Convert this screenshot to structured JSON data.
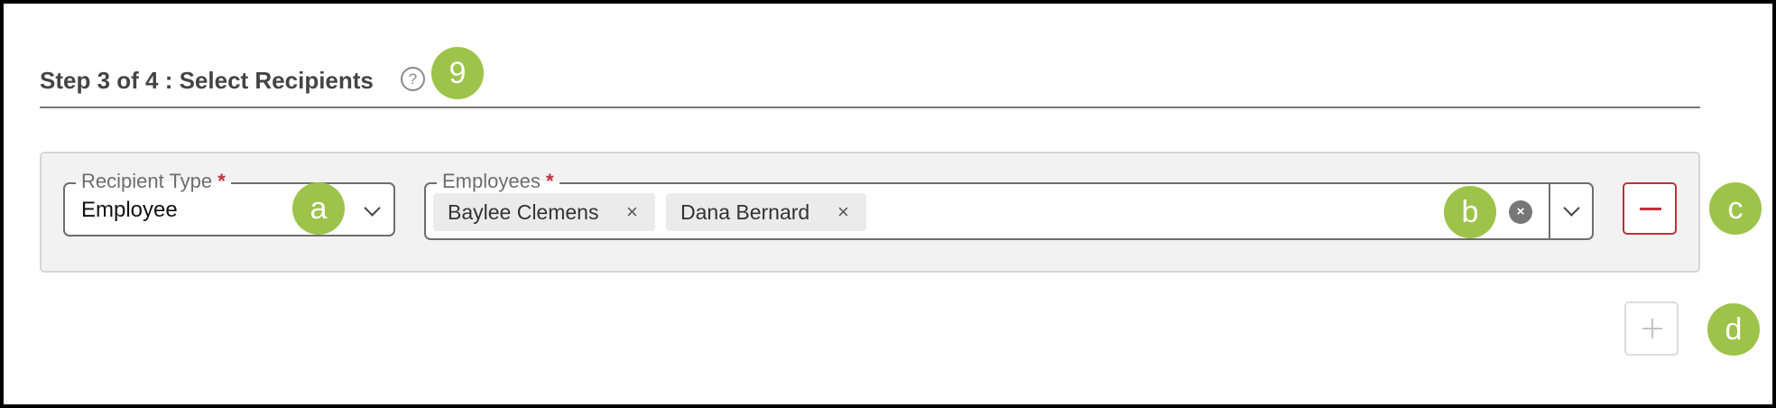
{
  "header": {
    "title": "Step 3 of 4 : Select Recipients",
    "help_icon": "help-circle-icon",
    "help_glyph": "?"
  },
  "recipient_type": {
    "label": "Recipient Type",
    "required_mark": "*",
    "value": "Employee"
  },
  "employees": {
    "label": "Employees",
    "required_mark": "*",
    "chips": [
      {
        "label": "Baylee Clemens"
      },
      {
        "label": "Dana Bernard"
      }
    ],
    "chip_remove_glyph": "×",
    "clear_glyph": "×"
  },
  "callouts": {
    "help": "9",
    "type": "a",
    "employees": "b",
    "remove": "c",
    "add": "d"
  },
  "colors": {
    "badge": "#9dc34a",
    "required": "#c0303a",
    "remove_button": "#c0303a",
    "row_background": "#f2f2f2"
  }
}
